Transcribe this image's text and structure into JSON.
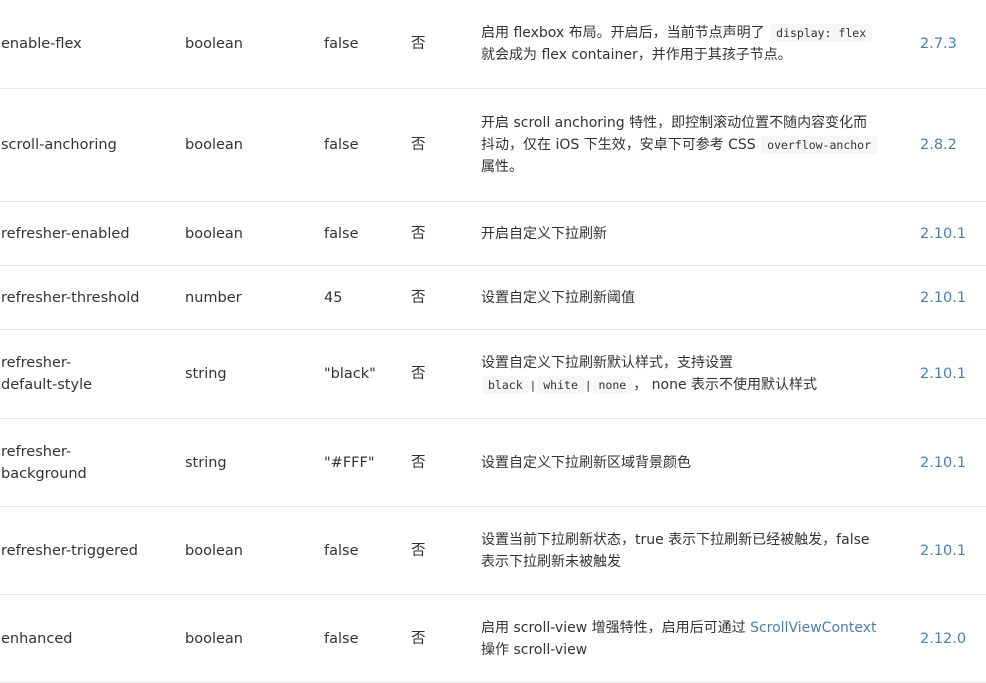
{
  "rows": [
    {
      "name": "enable-flex",
      "type": "boolean",
      "default": "false",
      "required": "否",
      "desc": {
        "pre": "启用 flexbox 布局。开启后，当前节点声明了 ",
        "code": "display: flex",
        "post": "就会成为 flex container，并作用于其孩子节点。"
      },
      "version": "2.7.3"
    },
    {
      "name": "scroll-anchoring",
      "type": "boolean",
      "default": "false",
      "required": "否",
      "desc": {
        "pre": "开启 scroll anchoring 特性，即控制滚动位置不随内容变化而抖动，仅在 iOS 下生效，安卓下可参考 CSS ",
        "code": "overflow-anchor",
        "post": "属性。"
      },
      "version": "2.8.2"
    },
    {
      "name": "refresher-enabled",
      "type": "boolean",
      "default": "false",
      "required": "否",
      "desc": {
        "text": "开启自定义下拉刷新"
      },
      "version": "2.10.1"
    },
    {
      "name": "refresher-threshold",
      "type": "number",
      "default": "45",
      "required": "否",
      "desc": {
        "text": "设置自定义下拉刷新阈值"
      },
      "version": "2.10.1"
    },
    {
      "name": "refresher-default-style",
      "type": "string",
      "default": "\"black\"",
      "required": "否",
      "desc": {
        "pre": "设置自定义下拉刷新默认样式，支持设置",
        "codes": [
          "black",
          "white",
          "none"
        ],
        "sep": "|",
        "post": "， none 表示不使用默认样式"
      },
      "version": "2.10.1"
    },
    {
      "name": "refresher-background",
      "type": "string",
      "default": "\"#FFF\"",
      "required": "否",
      "desc": {
        "text": "设置自定义下拉刷新区域背景颜色"
      },
      "version": "2.10.1"
    },
    {
      "name": "refresher-triggered",
      "type": "boolean",
      "default": "false",
      "required": "否",
      "desc": {
        "text": "设置当前下拉刷新状态，true 表示下拉刷新已经被触发，false 表示下拉刷新未被触发"
      },
      "version": "2.10.1"
    },
    {
      "name": "enhanced",
      "type": "boolean",
      "default": "false",
      "required": "否",
      "desc": {
        "pre": "启用 scroll-view 增强特性，启用后可通过 ",
        "link": "ScrollViewContext",
        "post": "操作 scroll-view"
      },
      "version": "2.12.0"
    }
  ],
  "colors": {
    "version_link": "#4c7fb0",
    "border": "#e6e6e6",
    "text": "#333333",
    "code_bg": "#f6f6f6"
  }
}
